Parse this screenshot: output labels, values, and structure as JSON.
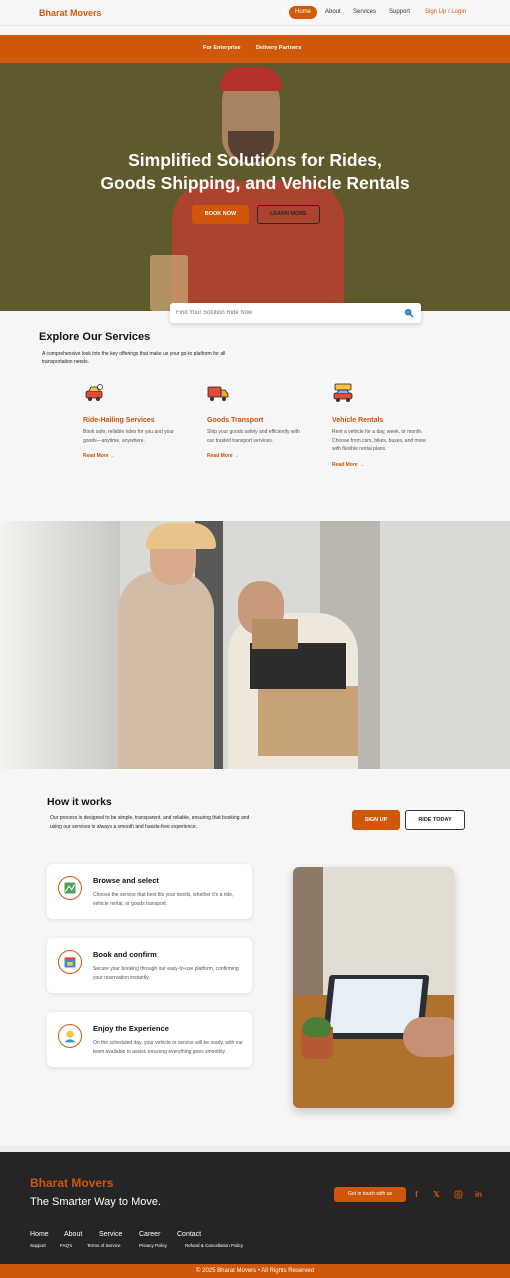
{
  "nav": {
    "brand": "Bharat Movers",
    "items": [
      "Home",
      "About",
      "Services",
      "Support"
    ],
    "login": "Sign Up / Login"
  },
  "subbar": {
    "items": [
      "For Enterprise",
      "Delivery Partners"
    ]
  },
  "hero": {
    "title_line1": "Simplified Solutions for Rides,",
    "title_line2": "Goods Shipping, and Vehicle Rentals",
    "book_now": "BOOK NOW",
    "learn_more": "LEARN MORE"
  },
  "search": {
    "placeholder": "Find Your Solution Ride Now"
  },
  "services": {
    "title": "Explore Our Services",
    "description": "A comprehensive look into the key offerings that make us your go-to platform for all transportation needs.",
    "items": [
      {
        "icon": "car-crash-icon",
        "title": "Ride-Hailing Services",
        "text": "Book safe, reliable rides for you and your goods—anytime, anywhere.",
        "link": "Read More →"
      },
      {
        "icon": "delivery-truck-icon",
        "title": "Goods Transport",
        "text": "Ship your goods safely and efficiently with our trusted transport services.",
        "link": "Read More →"
      },
      {
        "icon": "rental-car-icon",
        "title": "Vehicle Rentals",
        "text": "Rent a vehicle for a day, week, or month. Choose from cars, bikes, buses, and more with flexible rental plans.",
        "link": "Read More →"
      }
    ]
  },
  "how": {
    "title": "How it works",
    "description": "Our process is designed to be simple, transparent, and reliable, ensuring that booking and using our services is always a smooth and hassle-free experience.",
    "signup": "SIGN UP",
    "ride_today": "RIDE TODAY",
    "steps": [
      {
        "icon": "map-route-icon",
        "title": "Browse and select",
        "text": "Choose the service that best fits your needs, whether it's a ride, vehicle rental, or goods transport."
      },
      {
        "icon": "calendar-booking-icon",
        "title": "Book and confirm",
        "text": "Secure your booking through our easy-to-use platform, confirming your reservation instantly."
      },
      {
        "icon": "support-person-icon",
        "title": "Enjoy the Experience",
        "text": "On the scheduled day, your vehicle or service will be ready, with our team available to assist, ensuring everything goes smoothly."
      }
    ]
  },
  "footer": {
    "brand": "Bharat Movers",
    "tagline": "The Smarter Way to Move.",
    "cta": "Get in touch with us",
    "main_links": [
      "Home",
      "About",
      "Service",
      "Career",
      "Contact"
    ],
    "sub_links": [
      "Support",
      "FAQ's",
      "Terms of Service",
      "Privacy Policy",
      "Refund & Cancellation Policy"
    ],
    "copyright": "© 2025 Bharat Movers • All Rights Reserved"
  },
  "colors": {
    "accent": "#d2560a",
    "footer_bg": "#252525",
    "hero_bg": "#5e5a2b"
  }
}
